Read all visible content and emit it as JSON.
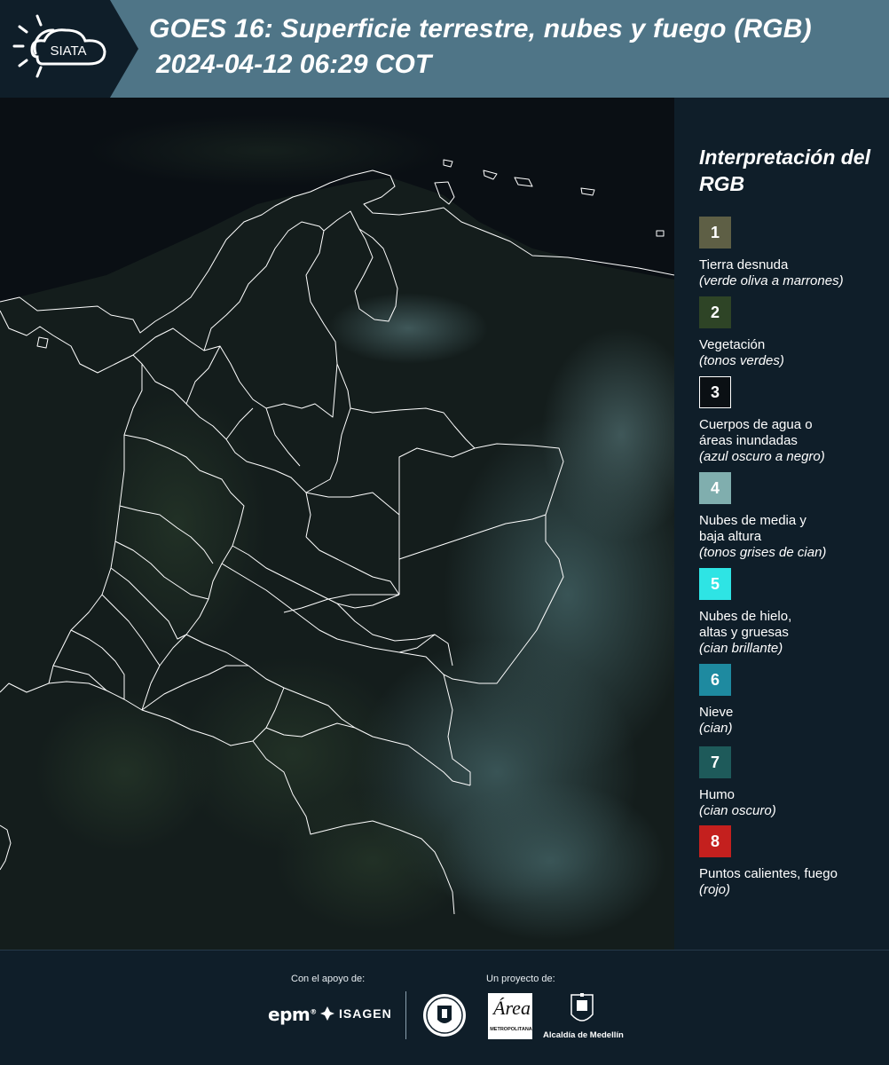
{
  "header": {
    "logo_text": "SIATA",
    "title": "GOES 16: Superficie terrestre, nubes y fuego (RGB)",
    "timestamp": "2024-04-12 06:29 COT"
  },
  "legend": {
    "title": "Interpretación del RGB",
    "items": [
      {
        "num": "1",
        "label": "Tierra desnuda",
        "desc": "(verde oliva a marrones)",
        "color": "#5e5f45",
        "text_color": "#ffffff",
        "border": ""
      },
      {
        "num": "2",
        "label": "Vegetación",
        "desc": "(tonos verdes)",
        "color": "#2e4426",
        "text_color": "#ffffff",
        "border": ""
      },
      {
        "num": "3",
        "label": "Cuerpos de agua o áreas inundadas",
        "desc": "(azul oscuro a negro)",
        "color": "#0b1014",
        "text_color": "#ffffff",
        "border": "#ffffff"
      },
      {
        "num": "4",
        "label": "Nubes de media y baja altura",
        "desc": "(tonos grises de cian)",
        "color": "#80aeae",
        "text_color": "#ffffff",
        "border": ""
      },
      {
        "num": "5",
        "label": "Nubes de hielo, altas y gruesas",
        "desc": "(cian brillante)",
        "color": "#2ee4e4",
        "text_color": "#ffffff",
        "border": ""
      },
      {
        "num": "6",
        "label": "Nieve",
        "desc": "(cian)",
        "color": "#1e8aa0",
        "text_color": "#ffffff",
        "border": ""
      },
      {
        "num": "7",
        "label": "Humo",
        "desc": "(cian oscuro)",
        "color": "#1e5a5a",
        "text_color": "#ffffff",
        "border": ""
      },
      {
        "num": "8",
        "label": "Puntos calientes, fuego",
        "desc": "(rojo)",
        "color": "#c4201e",
        "text_color": "#ffffff",
        "border": ""
      }
    ]
  },
  "footer": {
    "support_label": "Con el apoyo de:",
    "project_label": "Un proyecto de:",
    "epm": "epm",
    "isagen": "ISAGEN",
    "area_mark": "Área",
    "area_name": "METROPOLITANA",
    "alcaldia": "Alcaldía de Medellín"
  },
  "colors": {
    "header_bg": "#4f7587",
    "logo_bg": "#0f1e29",
    "page_bg": "#0f1e29",
    "map_bg": "#0a0f14",
    "border_line": "#ffffff"
  }
}
